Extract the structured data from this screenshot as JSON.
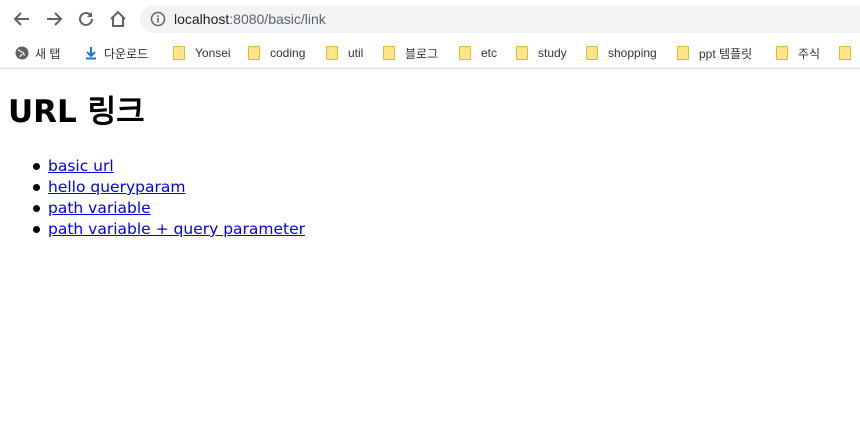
{
  "browser": {
    "url_host": "localhost",
    "url_rest": ":8080/basic/link",
    "bookmarks": [
      {
        "label": "새 탭",
        "icon": "globe-icon"
      },
      {
        "label": "다운로드",
        "icon": "download-icon"
      },
      {
        "label": "Yonsei",
        "icon": "folder-icon"
      },
      {
        "label": "coding",
        "icon": "folder-icon"
      },
      {
        "label": "util",
        "icon": "folder-icon"
      },
      {
        "label": "블로그",
        "icon": "folder-icon"
      },
      {
        "label": "etc",
        "icon": "folder-icon"
      },
      {
        "label": "study",
        "icon": "folder-icon"
      },
      {
        "label": "shopping",
        "icon": "folder-icon"
      },
      {
        "label": "ppt 템플릿",
        "icon": "folder-icon"
      },
      {
        "label": "주식",
        "icon": "folder-icon"
      }
    ]
  },
  "page": {
    "title": "URL 링크",
    "links": [
      {
        "label": "basic url"
      },
      {
        "label": "hello queryparam"
      },
      {
        "label": "path variable"
      },
      {
        "label": "path variable + query parameter"
      }
    ]
  },
  "colors": {
    "link": "#0000ee",
    "omnibox_bg": "#f1f3f4",
    "folder": "#ffe58a"
  }
}
